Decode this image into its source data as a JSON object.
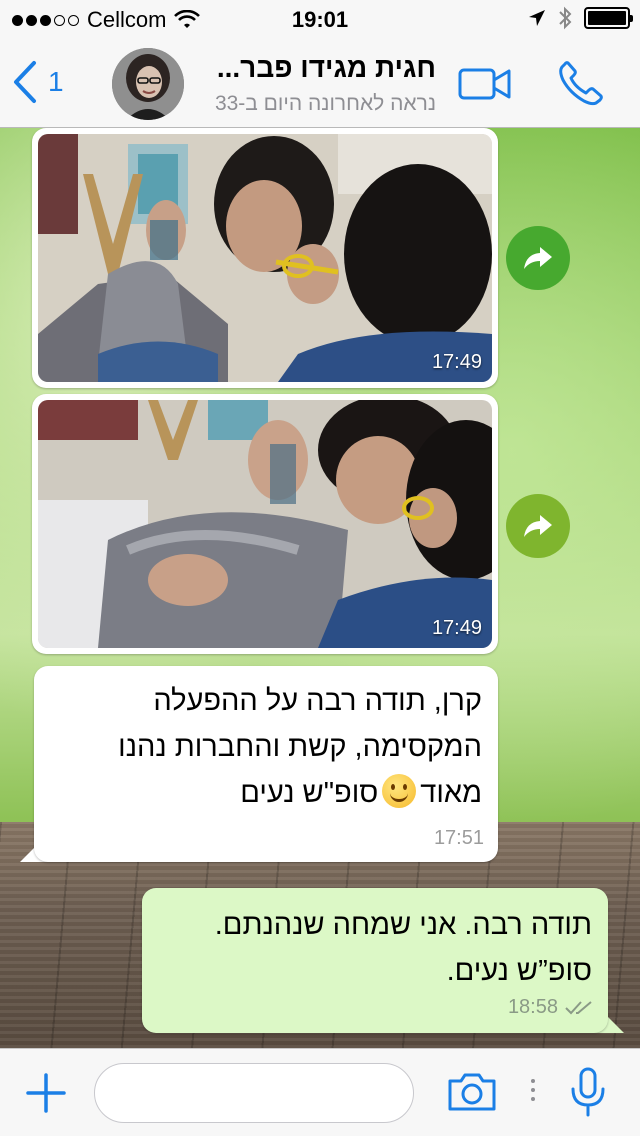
{
  "status_bar": {
    "carrier": "Cellcom",
    "time": "19:01",
    "signal_bars_filled": 3,
    "signal_bars_total": 5,
    "battery_level": 1.0
  },
  "header": {
    "back_count": "1",
    "contact_name": "חגית מגידו פבר...",
    "contact_status": "נראה לאחרונה היום ב-33"
  },
  "messages": [
    {
      "type": "image",
      "time": "17:49"
    },
    {
      "type": "image",
      "time": "17:49"
    },
    {
      "type": "text",
      "direction": "incoming",
      "lines": [
        "קרן, תודה רבה על ההפעלה",
        "המקסימה, קשת והחברות נהנו",
        "מאוד"
      ],
      "line3_after_emoji": "סופ\"ש נעים",
      "time": "17:51"
    },
    {
      "type": "text",
      "direction": "outgoing",
      "lines": [
        "תודה רבה. אני שמחה שנהנתם.",
        "סופ”ש נעים."
      ],
      "time": "18:58"
    }
  ],
  "input": {
    "placeholder": ""
  },
  "colors": {
    "accent": "#1b7fe6",
    "outgoing_bubble": "#dcf8c6",
    "forward_button": "#4caf32"
  },
  "icons": {
    "back": "chevron-left-icon",
    "video": "video-camera-icon",
    "call": "phone-icon",
    "forward": "share-arrow-icon",
    "add": "plus-icon",
    "camera": "camera-icon",
    "mic": "microphone-icon",
    "read_receipt": "double-check-icon"
  }
}
